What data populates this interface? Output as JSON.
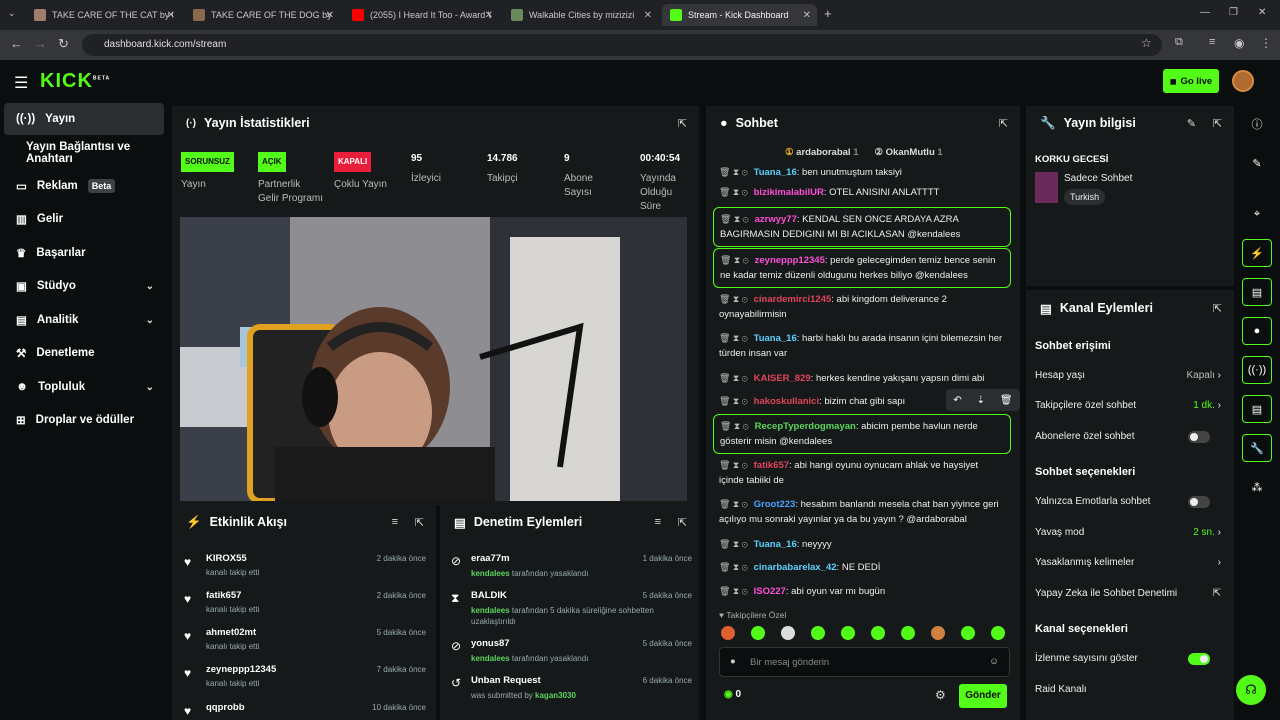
{
  "browser": {
    "tabs": [
      {
        "title": "TAKE CARE OF THE CAT by bo",
        "color": "#9e7e6a"
      },
      {
        "title": "TAKE CARE OF THE DOG by bo",
        "color": "#8a6a4a"
      },
      {
        "title": "(2055) I Heard It Too - Award W",
        "color": "#ff0000"
      },
      {
        "title": "Walkable Cities by mizizizi",
        "color": "#6a8a5a"
      },
      {
        "title": "Stream - Kick Dashboard",
        "color": "#53fc18"
      }
    ],
    "url": "dashboard.kick.com/stream"
  },
  "brand": {
    "logo": "KICK",
    "sup": "BETA",
    "go_live": "Go live"
  },
  "sidebar": [
    {
      "label": "Yayın",
      "icon": "broadcast-icon"
    },
    {
      "label": "Yayın Bağlantısı ve Anahtarı"
    },
    {
      "label": "Reklam",
      "badge": "Beta",
      "icon": "ad-icon"
    },
    {
      "label": "Gelir",
      "icon": "revenue-icon"
    },
    {
      "label": "Başarılar",
      "icon": "trophy-icon"
    },
    {
      "label": "Stüdyo",
      "icon": "studio-icon"
    },
    {
      "label": "Analitik",
      "icon": "analytics-icon"
    },
    {
      "label": "Denetleme",
      "icon": "moderation-icon"
    },
    {
      "label": "Topluluk",
      "icon": "community-icon"
    },
    {
      "label": "Droplar ve ödüller",
      "icon": "drops-icon"
    }
  ],
  "stats": {
    "title": "Yayın İstatistikleri",
    "items": [
      {
        "pill": "SORUNSUZ",
        "label": "Yayın",
        "pill_color": "#53fc18"
      },
      {
        "pill": "AÇIK",
        "label": "Partnerlik Gelir Programı",
        "pill_color": "#53fc18"
      },
      {
        "pill": "KAPALI",
        "label": "Çoklu Yayın",
        "pill_color": "#e91e3a"
      },
      {
        "value": "95",
        "label": "İzleyici"
      },
      {
        "value": "14.786",
        "label": "Takipçi"
      },
      {
        "value": "9",
        "label": "Abone Sayısı"
      },
      {
        "value": "00:40:54",
        "label": "Yayında Olduğu Süre"
      }
    ]
  },
  "activity": {
    "title": "Etkinlik Akışı",
    "items": [
      {
        "name": "KIROX55",
        "sub": "kanalı takip etti",
        "time": "2 dakika önce"
      },
      {
        "name": "fatik657",
        "sub": "kanalı takip etti",
        "time": "2 dakika önce"
      },
      {
        "name": "ahmet02mt",
        "sub": "kanalı takip etti",
        "time": "5 dakika önce"
      },
      {
        "name": "zeyneppp12345",
        "sub": "kanalı takip etti",
        "time": "7 dakika önce"
      },
      {
        "name": "qqprobb",
        "sub": "",
        "time": "10 dakika önce"
      }
    ]
  },
  "modlog": {
    "title": "Denetim Eylemleri",
    "items": [
      {
        "name": "eraa77m",
        "by": "kendalees",
        "rest": " tarafından yasaklandı",
        "time": "1 dakika önce"
      },
      {
        "name": "BALDIK",
        "by": "kendalees",
        "rest": " tarafından 5 dakika süreliğine sohbetten uzaklaştırıldı",
        "time": "5 dakika önce"
      },
      {
        "name": "yonus87",
        "by": "kendalees",
        "rest": " tarafından yasaklandı",
        "time": "5 dakika önce"
      },
      {
        "name": "Unban Request",
        "by": "kagan3030",
        "pre": "was submitted by ",
        "time": "6 dakika önce"
      }
    ]
  },
  "chat": {
    "title": "Sohbet",
    "pinned": [
      {
        "name": "ardaborabal",
        "count": "1"
      },
      {
        "name": "OkanMutlu",
        "count": "1"
      }
    ],
    "messages": [
      {
        "user": "Tuana_16",
        "color": "#5ad1ff",
        "text": "ben unutmuştum taksiyi"
      },
      {
        "user": "bizikimalabilUR",
        "color": "#ff4fd8",
        "text": "OTEL ANISINI ANLATTTT"
      },
      {
        "user": "azrwyy77",
        "color": "#ff4fd8",
        "text": "KENDAL SEN ONCE ARDAYA AZRA BAGIRMASIN DEDIGINI MI BI ACIKLASAN @kendalees",
        "hl": true
      },
      {
        "user": "zeyneppp12345",
        "color": "#ff4fd8",
        "text": "perde gelecegimden temiz bence senin ne kadar temiz düzenli oldugunu herkes biliyo @kendalees",
        "hl": true
      },
      {
        "user": "cinardemirci1245",
        "color": "#e0455a",
        "text": "abi kingdom deliverance 2 oynayabilirmisin"
      },
      {
        "user": "Tuana_16",
        "color": "#5ad1ff",
        "text": "harbi haklı bu arada insanın içini bilemezsin her türden insan var"
      },
      {
        "user": "KAISER_829",
        "color": "#e0455a",
        "text": "herkes kendine yakışanı yapsın dimi abi"
      },
      {
        "user": "hakoskullanici",
        "color": "#e0455a",
        "text": "bizim chat gibi sapı"
      },
      {
        "user": "RecepTyperdogmayan",
        "color": "#5bd65b",
        "text": "abicim pembe havlun nerde gösterir misin @kendalees",
        "hl": true
      },
      {
        "user": "fatik657",
        "color": "#e0455a",
        "text": "abi hangi oyunu oynucam ahlak ve haysiyet içinde tabiiki de"
      },
      {
        "user": "Groot223",
        "color": "#4aa3ff",
        "text": "hesabım banlandı mesela chat ban yiyince geri açılıyo mu sonraki yayınlar ya da bu yayın ? @ardaborabal"
      },
      {
        "user": "Tuana_16",
        "color": "#5ad1ff",
        "text": "neyyyy"
      },
      {
        "user": "cinarbabarelax_42",
        "color": "#5ad1ff",
        "text": "NE DEDİ"
      },
      {
        "user": "ISO227",
        "color": "#ff4fd8",
        "text": "abi oyun var mı bugün"
      }
    ],
    "followers_only": "Takipçilere Özel",
    "placeholder": "Bir mesaj gönderin",
    "count": "0",
    "send": "Gönder"
  },
  "info": {
    "title": "Yayın bilgisi",
    "stream_title": "KORKU GECESİ",
    "category": "Sadece Sohbet",
    "tag": "Turkish"
  },
  "actions": {
    "title": "Kanal Eylemleri",
    "sec1": "Sohbet erişimi",
    "r1": "Hesap yaşı",
    "r1v": "Kapalı",
    "r2": "Takipçilere özel sohbet",
    "r2v": "1 dk.",
    "r3": "Abonelere özel sohbet",
    "sec2": "Sohbet seçenekleri",
    "r4": "Yalnızca Emotlarla sohbet",
    "r5": "Yavaş mod",
    "r5v": "2 sn.",
    "r6": "Yasaklanmış kelimeler",
    "r7": "Yapay Zeka ile Sohbet Denetimi",
    "sec3": "Kanal seçenekleri",
    "r8": "İzlenme sayısını göster",
    "r9": "Raid Kanalı"
  }
}
